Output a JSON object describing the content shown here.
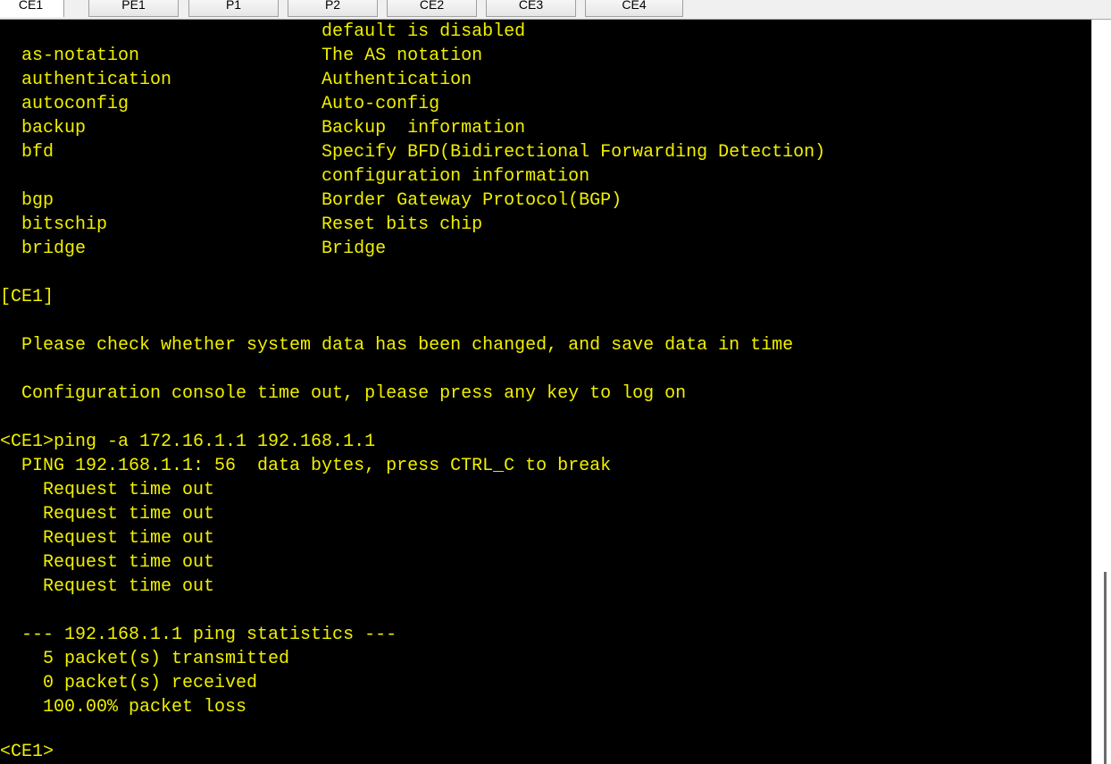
{
  "tabs": [
    {
      "label": "CE1",
      "active": true
    },
    {
      "label": "PE1",
      "active": false
    },
    {
      "label": "P1",
      "active": false
    },
    {
      "label": "P2",
      "active": false
    },
    {
      "label": "CE2",
      "active": false
    },
    {
      "label": "CE3",
      "active": false
    },
    {
      "label": "CE4",
      "active": false
    }
  ],
  "terminal": {
    "lines": [
      "                              default is disabled",
      "  as-notation                 The AS notation",
      "  authentication              Authentication",
      "  autoconfig                  Auto-config",
      "  backup                      Backup  information",
      "  bfd                         Specify BFD(Bidirectional Forwarding Detection)",
      "                              configuration information",
      "  bgp                         Border Gateway Protocol(BGP)",
      "  bitschip                    Reset bits chip",
      "  bridge                      Bridge",
      "",
      "[CE1]",
      "",
      "  Please check whether system data has been changed, and save data in time",
      "",
      "  Configuration console time out, please press any key to log on",
      "",
      "<CE1>ping -a 172.16.1.1 192.168.1.1",
      "  PING 192.168.1.1: 56  data bytes, press CTRL_C to break",
      "    Request time out",
      "    Request time out",
      "    Request time out",
      "    Request time out",
      "    Request time out",
      "",
      "  --- 192.168.1.1 ping statistics ---",
      "    5 packet(s) transmitted",
      "    0 packet(s) received",
      "    100.00% packet loss",
      "",
      "<CE1>"
    ]
  },
  "colors": {
    "terminal_bg": "#000000",
    "terminal_text": "#f0f000"
  }
}
